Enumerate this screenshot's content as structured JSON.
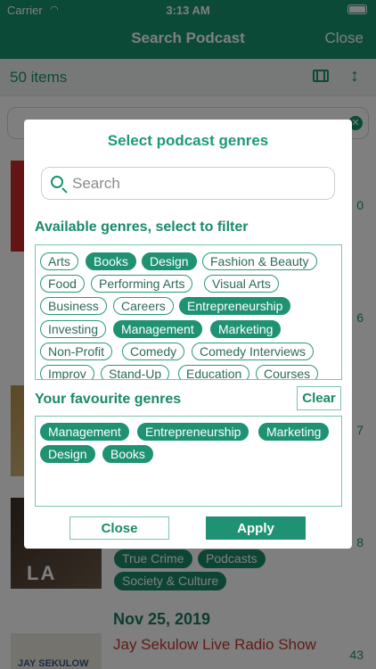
{
  "status_bar": {
    "carrier": "Carrier",
    "time": "3:13 AM"
  },
  "nav": {
    "title": "Search Podcast",
    "close_label": "Close"
  },
  "toolbar": {
    "count": "50 items"
  },
  "background_rows": {
    "numbers": [
      "0",
      "6",
      "7",
      "8",
      "43"
    ],
    "chips_row3": [
      "True Crime",
      "Podcasts",
      "Society & Culture"
    ],
    "artwork_text_row3": "LA",
    "row4_date": "Nov 25, 2019",
    "row4_title": "Jay Sekulow Live Radio Show",
    "artwork_text_row4": "JAY SEKULOW"
  },
  "modal": {
    "title": "Select podcast genres",
    "search_placeholder": "Search",
    "available_label": "Available genres, select to filter",
    "available": [
      "Arts",
      "Books",
      "Design",
      "Fashion & Beauty",
      "Food",
      "Performing Arts",
      "Visual Arts",
      "Business",
      "Careers",
      "Entrepreneurship",
      "Investing",
      "Management",
      "Marketing",
      "Non-Profit",
      "Comedy",
      "Comedy Interviews",
      "Improv",
      "Stand-Up",
      "Education",
      "Courses"
    ],
    "favourites_label": "Your favourite genres",
    "clear_label": "Clear",
    "favourites": [
      "Management",
      "Entrepreneurship",
      "Marketing",
      "Design",
      "Books"
    ],
    "close_label": "Close",
    "apply_label": "Apply"
  },
  "colors": {
    "accent": "#17946f",
    "chip_selected": "#1e9272",
    "warning_text": "#c0392b"
  }
}
